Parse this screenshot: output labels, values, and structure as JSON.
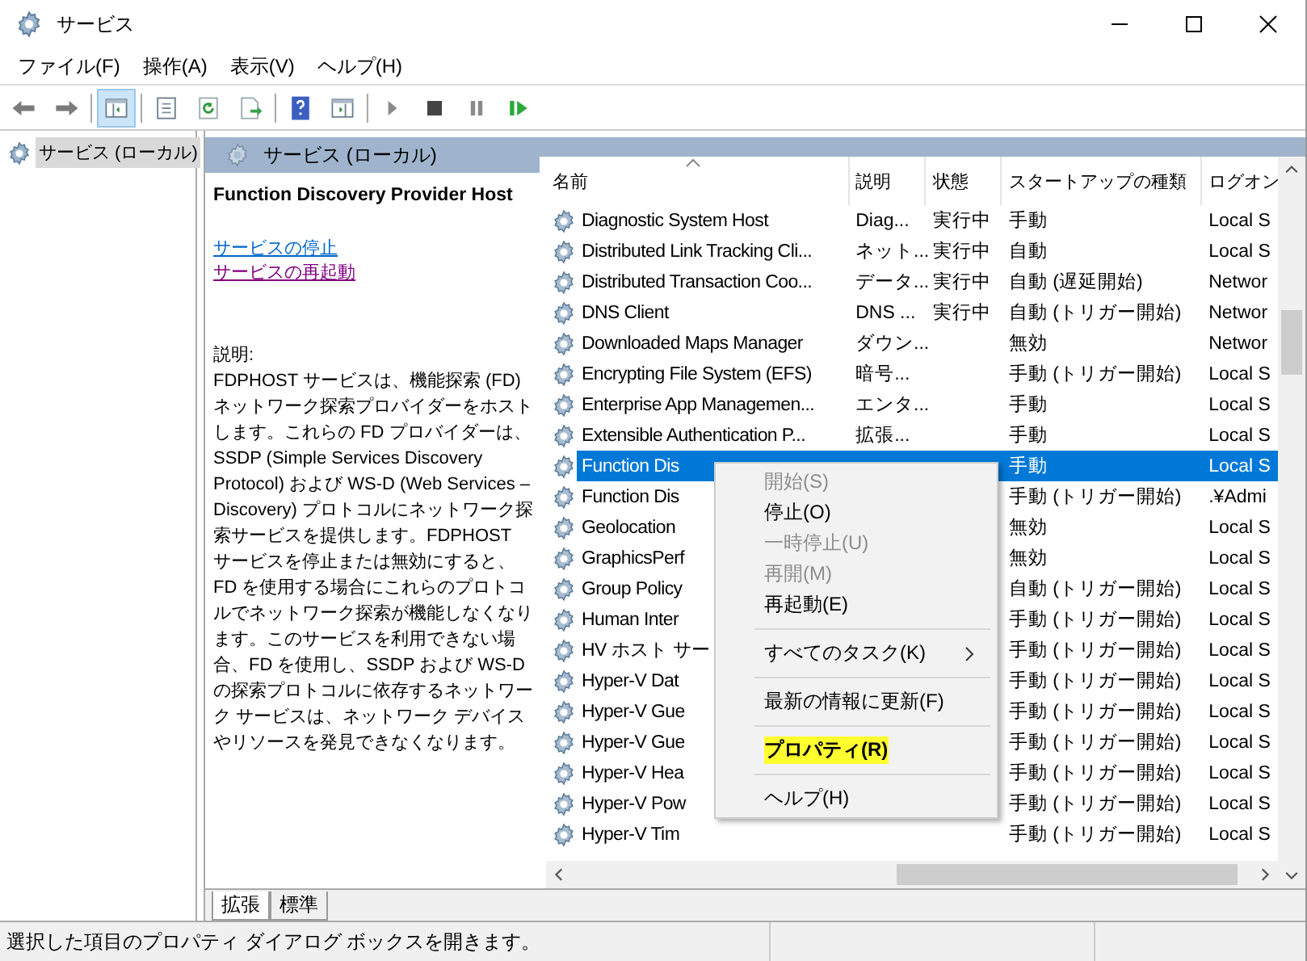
{
  "window": {
    "title": "サービス"
  },
  "menu_bar": [
    "ファイル(F)",
    "操作(A)",
    "表示(V)",
    "ヘルプ(H)"
  ],
  "toolbar": [
    {
      "kind": "back"
    },
    {
      "kind": "forward"
    },
    {
      "kind": "sep"
    },
    {
      "kind": "tree",
      "selected": true
    },
    {
      "kind": "sep"
    },
    {
      "kind": "props"
    },
    {
      "kind": "refresh"
    },
    {
      "kind": "export"
    },
    {
      "kind": "sep"
    },
    {
      "kind": "help"
    },
    {
      "kind": "console"
    },
    {
      "kind": "sep"
    },
    {
      "kind": "play"
    },
    {
      "kind": "stop"
    },
    {
      "kind": "pause"
    },
    {
      "kind": "resume"
    }
  ],
  "tree": {
    "items": [
      {
        "label": "サービス (ローカル)",
        "selected": true
      }
    ]
  },
  "panel": {
    "title": "サービス (ローカル)"
  },
  "details": {
    "service_name": "Function Discovery Provider Host",
    "links": [
      "サービスの停止",
      "サービスの再起動"
    ],
    "description_label": "説明:",
    "description": "FDPHOST サービスは、機能探索 (FD) ネットワーク探索プロバイダーをホストします。これらの FD プロバイダーは、SSDP (Simple Services Discovery Protocol) および WS-D (Web Services – Discovery) プロトコルにネットワーク探索サービスを提供します。FDPHOST サービスを停止または無効にすると、FD を使用する場合にこれらのプロトコルでネットワーク探索が機能しなくなります。このサービスを利用できない場合、FD を使用し、SSDP および WS-D の探索プロトコルに依存するネットワーク サービスは、ネットワーク デバイスやリソースを発見できなくなります。"
  },
  "table": {
    "columns": [
      "名前",
      "説明",
      "状態",
      "スタートアップの種類",
      "ログオン"
    ],
    "rows": [
      {
        "name": "Diagnostic System Host",
        "description": "Diag...",
        "status": "実行中",
        "startup": "手動",
        "logon": "Local S",
        "selected": false
      },
      {
        "name": "Distributed Link Tracking Cli...",
        "description": "ネット...",
        "status": "実行中",
        "startup": "自動",
        "logon": "Local S",
        "selected": false
      },
      {
        "name": "Distributed Transaction Coo...",
        "description": "データ...",
        "status": "実行中",
        "startup": "自動 (遅延開始)",
        "logon": "Networ",
        "selected": false
      },
      {
        "name": "DNS Client",
        "description": "DNS ...",
        "status": "実行中",
        "startup": "自動 (トリガー開始)",
        "logon": "Networ",
        "selected": false
      },
      {
        "name": "Downloaded Maps Manager",
        "description": "ダウン...",
        "startup": "無効",
        "logon": "Networ",
        "selected": false
      },
      {
        "name": "Encrypting File System (EFS)",
        "description": "暗号...",
        "startup": "手動 (トリガー開始)",
        "logon": "Local S",
        "selected": false
      },
      {
        "name": "Enterprise App Managemen...",
        "description": "エンタ...",
        "startup": "手動",
        "logon": "Local S",
        "selected": false
      },
      {
        "name": "Extensible Authentication P...",
        "description": "拡張...",
        "startup": "手動",
        "logon": "Local S",
        "selected": false
      },
      {
        "name": "Function Dis",
        "startup": "手動",
        "logon": "Local S",
        "selected": true
      },
      {
        "name": "Function Dis",
        "startup": "手動 (トリガー開始)",
        "logon": ".¥Admi",
        "selected": false
      },
      {
        "name": "Geolocation",
        "startup": "無効",
        "logon": "Local S",
        "selected": false
      },
      {
        "name": "GraphicsPerf",
        "startup": "無効",
        "logon": "Local S",
        "selected": false
      },
      {
        "name": "Group Policy",
        "startup": "自動 (トリガー開始)",
        "logon": "Local S",
        "selected": false
      },
      {
        "name": "Human Inter",
        "startup": "手動 (トリガー開始)",
        "logon": "Local S",
        "selected": false
      },
      {
        "name": "HV ホスト サー",
        "startup": "手動 (トリガー開始)",
        "logon": "Local S",
        "selected": false
      },
      {
        "name": "Hyper-V Dat",
        "startup": "手動 (トリガー開始)",
        "logon": "Local S",
        "selected": false
      },
      {
        "name": "Hyper-V Gue",
        "startup": "手動 (トリガー開始)",
        "logon": "Local S",
        "selected": false
      },
      {
        "name": "Hyper-V Gue",
        "startup": "手動 (トリガー開始)",
        "logon": "Local S",
        "selected": false
      },
      {
        "name": "Hyper-V Hea",
        "startup": "手動 (トリガー開始)",
        "logon": "Local S",
        "selected": false
      },
      {
        "name": "Hyper-V Pow",
        "startup": "手動 (トリガー開始)",
        "logon": "Local S",
        "selected": false
      },
      {
        "name": "Hyper-V Tim",
        "startup": "手動 (トリガー開始)",
        "logon": "Local S",
        "selected": false
      }
    ]
  },
  "context_menu": [
    {
      "kind": "item",
      "label": "開始(S)",
      "disabled": true,
      "highlighted": false
    },
    {
      "kind": "item",
      "label": "停止(O)",
      "disabled": false,
      "highlighted": false
    },
    {
      "kind": "item",
      "label": "一時停止(U)",
      "disabled": true,
      "highlighted": false
    },
    {
      "kind": "item",
      "label": "再開(M)",
      "disabled": true,
      "highlighted": false
    },
    {
      "kind": "item",
      "label": "再起動(E)",
      "disabled": false,
      "highlighted": false
    },
    {
      "kind": "separator"
    },
    {
      "kind": "item",
      "label": "すべてのタスク(K)",
      "disabled": false,
      "highlighted": false,
      "submenu": true
    },
    {
      "kind": "separator"
    },
    {
      "kind": "item",
      "label": "最新の情報に更新(F)",
      "disabled": false,
      "highlighted": false
    },
    {
      "kind": "separator"
    },
    {
      "kind": "item",
      "label": "プロパティ(R)",
      "disabled": false,
      "highlighted": true
    },
    {
      "kind": "separator"
    },
    {
      "kind": "item",
      "label": "ヘルプ(H)",
      "disabled": false,
      "highlighted": false
    }
  ],
  "view_tabs": [
    {
      "label": "拡張",
      "selected": true
    },
    {
      "label": "標準",
      "selected": false
    }
  ],
  "status_bar": {
    "text": "選択した項目のプロパティ ダイアログ ボックスを開きます。"
  }
}
